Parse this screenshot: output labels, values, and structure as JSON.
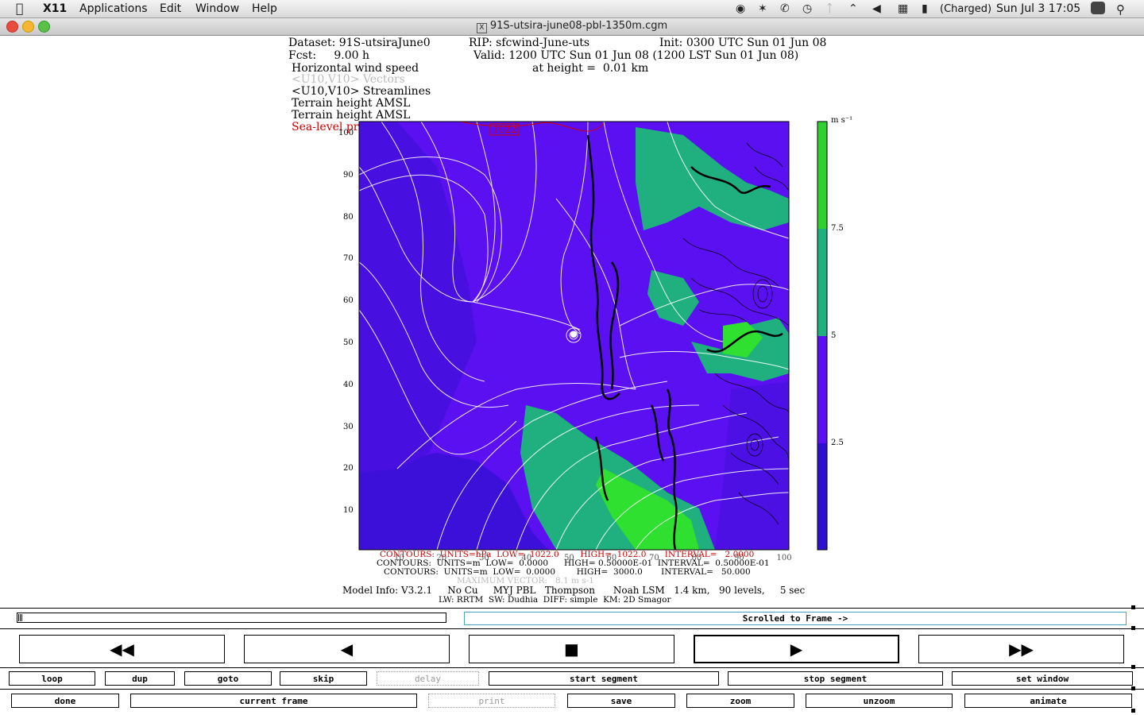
{
  "menubar": {
    "app": "X11",
    "items": [
      "Applications",
      "Edit",
      "Window",
      "Help"
    ],
    "battery": "(Charged)",
    "datetime": "Sun Jul 3  17:05",
    "icons": [
      "apple-icon",
      "network-icon",
      "bluetooth-icon",
      "time-machine-icon",
      "wifi-icon",
      "volume-icon",
      "keyboard-icon",
      "battery-icon",
      "user-icon",
      "spotlight-icon"
    ]
  },
  "window": {
    "title": "91S-utsira-june08-pbl-1350m.cgm"
  },
  "plot": {
    "header": {
      "dataset": "Dataset: 91S-utsiraJune0",
      "rip": "RIP: sfcwind-June-uts",
      "init": "Init: 0300 UTC Sun 01 Jun 08",
      "fcst": "Fcst:     9.00 h",
      "valid": "Valid: 1200 UTC Sun 01 Jun 08 (1200 LST Sun 01 Jun 08)",
      "field": "Horizontal wind speed",
      "height": "at height =  0.01 km",
      "legend_lines": [
        {
          "text": "<U10,V10> Vectors",
          "color": "#bbbbbb"
        },
        {
          "text": "<U10,V10> Streamlines",
          "color": "#000000"
        },
        {
          "text": "Terrain height AMSL",
          "color": "#000000"
        },
        {
          "text": "Terrain height AMSL",
          "color": "#000000"
        },
        {
          "text": "Sea-level pressure",
          "color": "#d00000"
        }
      ]
    },
    "pressure_label": "1022",
    "y_ticks": [
      "100",
      "90",
      "80",
      "70",
      "60",
      "50",
      "40",
      "30",
      "20",
      "10"
    ],
    "x_ticks": [
      "10",
      "20",
      "30",
      "40",
      "50",
      "60",
      "70",
      "80",
      "90",
      "100"
    ],
    "colorbar": {
      "units": "m s⁻¹",
      "labels": [
        "7.5",
        "5",
        "2.5"
      ],
      "colors": [
        "#30d030",
        "#20b080",
        "#5a10f0",
        "#3010d0"
      ]
    },
    "footer": [
      {
        "text": "CONTOURS:  UNITS=hPa  LOW=  1022.0        HIGH=  1022.0       INTERVAL=   2.0000",
        "color": "#d00000"
      },
      {
        "text": "CONTOURS:  UNITS=m  LOW=  0.0000      HIGH= 0.50000E-01  INTERVAL=  0.50000E-01",
        "color": "#000000"
      },
      {
        "text": "CONTOURS:  UNITS=m  LOW=  0.0000        HIGH=  3000.0       INTERVAL=   50.000",
        "color": "#000000"
      },
      {
        "text": "MAXIMUM VECTOR:   8.1 m s-1",
        "color": "#bbbbbb"
      }
    ],
    "model_info_1": "Model Info: V3.2.1     No Cu     MYJ PBL   Thompson      Noah LSM   1.4 km,   90 levels,     5 sec",
    "model_info_2": "LW: RRTM  SW: Dudhia  DIFF: simple  KM: 2D Smagor"
  },
  "controls": {
    "scroll_status": "Scrolled to Frame ->",
    "transport": [
      {
        "name": "rewind-button",
        "glyph": "◀◀"
      },
      {
        "name": "step-back-button",
        "glyph": "◀"
      },
      {
        "name": "stop-button",
        "glyph": "■"
      },
      {
        "name": "play-button",
        "glyph": "▶"
      },
      {
        "name": "fast-forward-button",
        "glyph": "▶▶"
      }
    ],
    "row1": [
      {
        "label": "loop",
        "enabled": true
      },
      {
        "label": "dup",
        "enabled": true
      },
      {
        "label": "goto",
        "enabled": true
      },
      {
        "label": "skip",
        "enabled": true
      },
      {
        "label": "delay",
        "enabled": false
      },
      {
        "label": "start segment",
        "enabled": true
      },
      {
        "label": "stop segment",
        "enabled": true
      },
      {
        "label": "set window",
        "enabled": true
      }
    ],
    "row2": [
      {
        "label": "done",
        "enabled": true
      },
      {
        "label": "current frame",
        "enabled": true
      },
      {
        "label": "print",
        "enabled": false
      },
      {
        "label": "save",
        "enabled": true
      },
      {
        "label": "zoom",
        "enabled": true
      },
      {
        "label": "unzoom",
        "enabled": true
      },
      {
        "label": "animate",
        "enabled": true
      }
    ]
  }
}
